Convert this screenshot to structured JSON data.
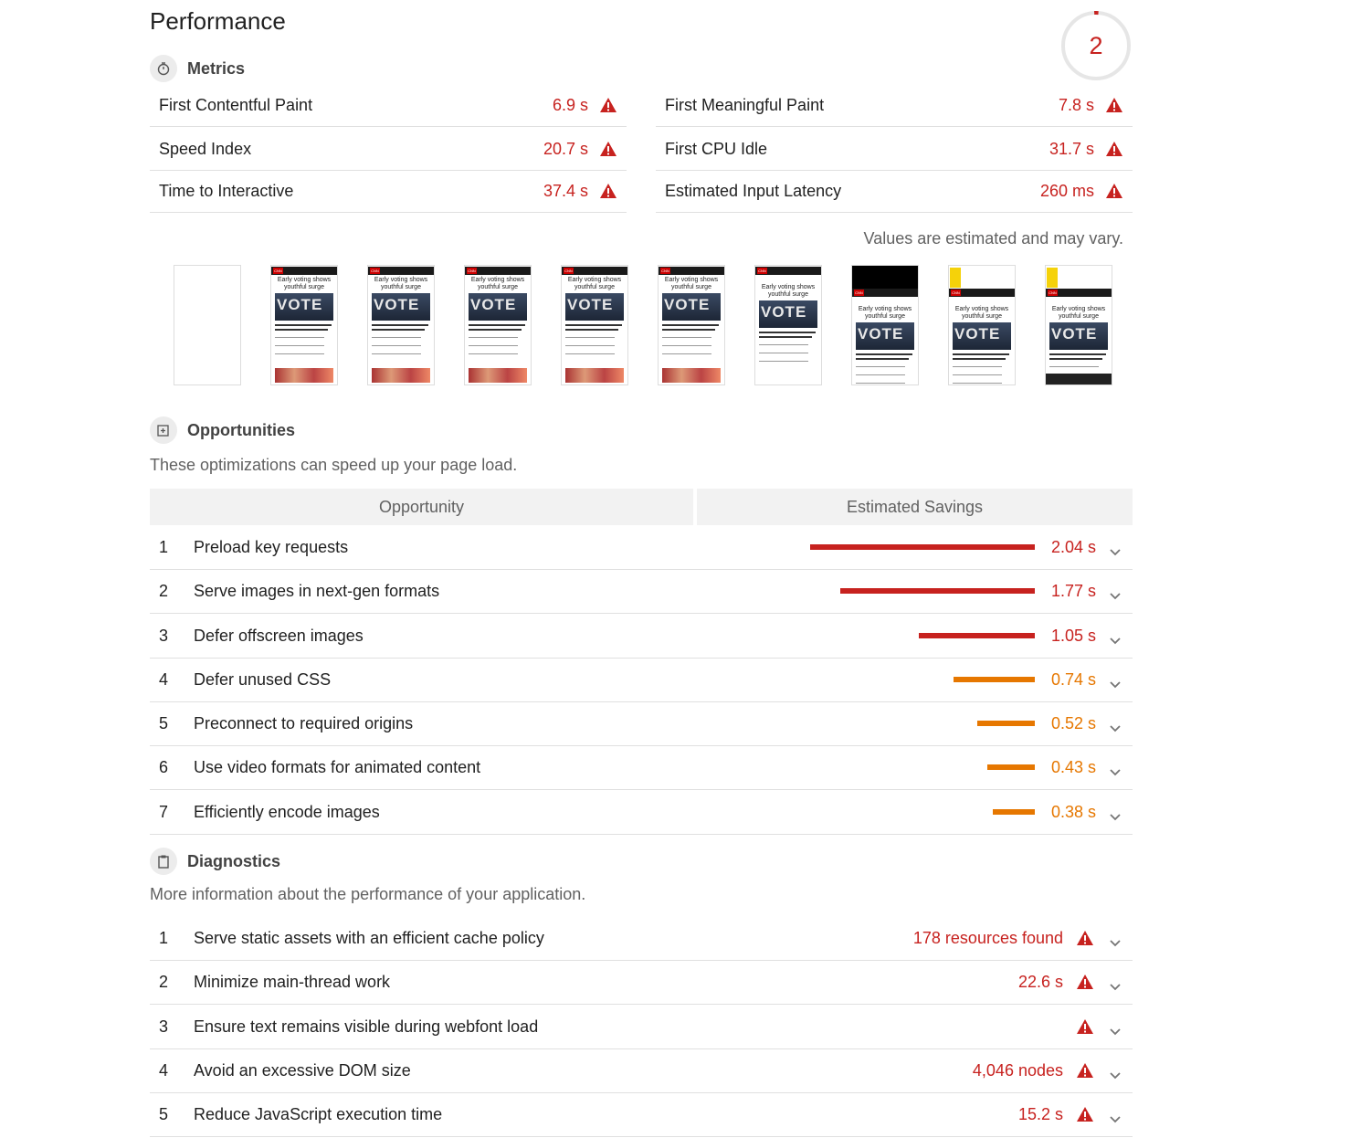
{
  "header": {
    "title": "Performance",
    "score": "2"
  },
  "metrics": {
    "heading": "Metrics",
    "items": [
      {
        "label": "First Contentful Paint",
        "value": "6.9 s"
      },
      {
        "label": "First Meaningful Paint",
        "value": "7.8 s"
      },
      {
        "label": "Speed Index",
        "value": "20.7 s"
      },
      {
        "label": "First CPU Idle",
        "value": "31.7 s"
      },
      {
        "label": "Time to Interactive",
        "value": "37.4 s"
      },
      {
        "label": "Estimated Input Latency",
        "value": "260 ms"
      }
    ],
    "note": "Values are estimated and may vary."
  },
  "filmstrip": {
    "frames": 10
  },
  "opportunities": {
    "heading": "Opportunities",
    "description": "These optimizations can speed up your page load.",
    "col_opportunity": "Opportunity",
    "col_savings": "Estimated Savings",
    "items": [
      {
        "num": "1",
        "label": "Preload key requests",
        "savings": "2.04 s",
        "seconds": 2.04,
        "level": "red"
      },
      {
        "num": "2",
        "label": "Serve images in next-gen formats",
        "savings": "1.77 s",
        "seconds": 1.77,
        "level": "red"
      },
      {
        "num": "3",
        "label": "Defer offscreen images",
        "savings": "1.05 s",
        "seconds": 1.05,
        "level": "red"
      },
      {
        "num": "4",
        "label": "Defer unused CSS",
        "savings": "0.74 s",
        "seconds": 0.74,
        "level": "orange"
      },
      {
        "num": "5",
        "label": "Preconnect to required origins",
        "savings": "0.52 s",
        "seconds": 0.52,
        "level": "orange"
      },
      {
        "num": "6",
        "label": "Use video formats for animated content",
        "savings": "0.43 s",
        "seconds": 0.43,
        "level": "orange"
      },
      {
        "num": "7",
        "label": "Efficiently encode images",
        "savings": "0.38 s",
        "seconds": 0.38,
        "level": "orange"
      }
    ]
  },
  "diagnostics": {
    "heading": "Diagnostics",
    "description": "More information about the performance of your application.",
    "items": [
      {
        "num": "1",
        "label": "Serve static assets with an efficient cache policy",
        "value": "178 resources found"
      },
      {
        "num": "2",
        "label": "Minimize main-thread work",
        "value": "22.6 s"
      },
      {
        "num": "3",
        "label": "Ensure text remains visible during webfont load",
        "value": ""
      },
      {
        "num": "4",
        "label": "Avoid an excessive DOM size",
        "value": "4,046 nodes"
      },
      {
        "num": "5",
        "label": "Reduce JavaScript execution time",
        "value": "15.2 s"
      }
    ]
  },
  "colors": {
    "fail": "#c7221f",
    "average": "#e67700"
  },
  "frame_texts": {
    "logo": "CNN",
    "headline": "Early voting shows youthful surge",
    "image_text": "VOTE"
  }
}
